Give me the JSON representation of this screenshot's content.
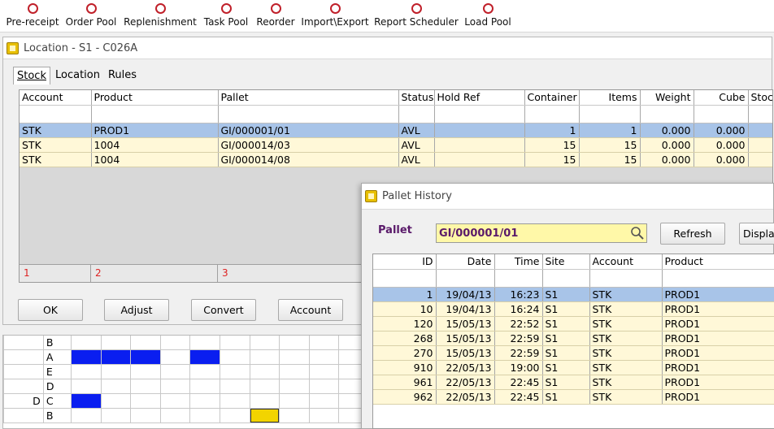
{
  "toolbar": {
    "items": [
      {
        "label": "Pre-receipt"
      },
      {
        "label": "Order Pool"
      },
      {
        "label": "Replenishment"
      },
      {
        "label": "Task Pool"
      },
      {
        "label": "Reorder"
      },
      {
        "label": "Import\\Export"
      },
      {
        "label": "Report Scheduler"
      },
      {
        "label": "Load Pool"
      }
    ]
  },
  "location_window": {
    "title": "Location - S1 - C026A",
    "tabs": [
      "Stock",
      "Location",
      "Rules"
    ],
    "grid": {
      "columns": [
        "Account",
        "Product",
        "Pallet",
        "Status",
        "Hold Ref",
        "Container",
        "Items",
        "Weight",
        "Cube",
        "Stoc"
      ],
      "rows": [
        [
          "STK",
          "PROD1",
          "GI/000001/01",
          "AVL",
          "",
          "1",
          "1",
          "0.000",
          "0.000",
          ""
        ],
        [
          "STK",
          "1004",
          "GI/000014/03",
          "AVL",
          "",
          "15",
          "15",
          "0.000",
          "0.000",
          ""
        ],
        [
          "STK",
          "1004",
          "GI/000014/08",
          "AVL",
          "",
          "15",
          "15",
          "0.000",
          "0.000",
          ""
        ]
      ],
      "summary": [
        "1",
        "2",
        "3"
      ]
    },
    "buttons": {
      "ok": "OK",
      "adjust": "Adjust",
      "convert": "Convert",
      "account": "Account"
    }
  },
  "location_map": {
    "rows": [
      {
        "group": "",
        "label": "B"
      },
      {
        "group": "",
        "label": "A"
      },
      {
        "group": "",
        "label": "E"
      },
      {
        "group": "",
        "label": "D"
      },
      {
        "group": "D",
        "label": "C"
      },
      {
        "group": "",
        "label": "B"
      }
    ]
  },
  "pallet_history": {
    "title": "Pallet History",
    "pallet_label": "Pallet",
    "pallet_value": "GI/000001/01",
    "refresh_label": "Refresh",
    "display_label": "Displa",
    "grid": {
      "columns": [
        "ID",
        "Date",
        "Time",
        "Site",
        "Account",
        "Product"
      ],
      "rows": [
        [
          "1",
          "19/04/13",
          "16:23",
          "S1",
          "STK",
          "PROD1"
        ],
        [
          "10",
          "19/04/13",
          "16:24",
          "S1",
          "STK",
          "PROD1"
        ],
        [
          "120",
          "15/05/13",
          "22:52",
          "S1",
          "STK",
          "PROD1"
        ],
        [
          "268",
          "15/05/13",
          "22:59",
          "S1",
          "STK",
          "PROD1"
        ],
        [
          "270",
          "15/05/13",
          "22:59",
          "S1",
          "STK",
          "PROD1"
        ],
        [
          "910",
          "22/05/13",
          "19:00",
          "S1",
          "STK",
          "PROD1"
        ],
        [
          "961",
          "22/05/13",
          "22:45",
          "S1",
          "STK",
          "PROD1"
        ],
        [
          "962",
          "22/05/13",
          "22:45",
          "S1",
          "STK",
          "PROD1"
        ]
      ]
    }
  },
  "colors": {
    "accent_red": "#c0202a",
    "selected_row": "#a8c4e8",
    "row_bg": "#fff8d8",
    "pallet_input_bg": "#fff8a8",
    "map_blue": "#0a1ef0",
    "map_red": "#f01818",
    "map_yellow": "#f2d400"
  }
}
